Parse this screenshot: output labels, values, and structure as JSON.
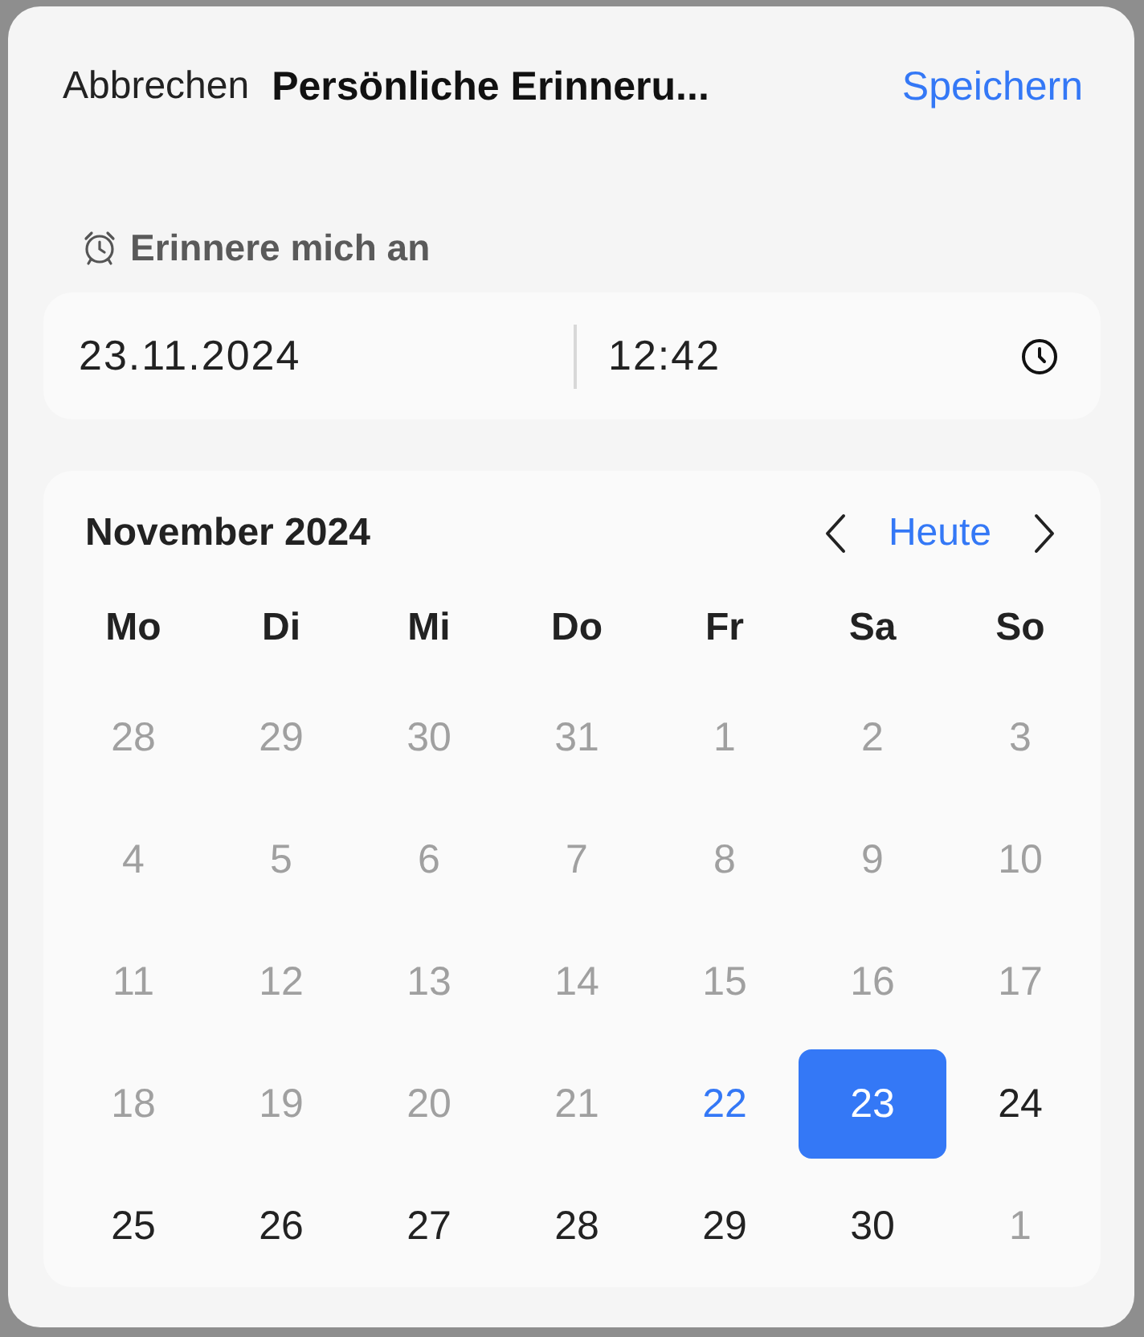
{
  "header": {
    "cancel": "Abbrechen",
    "title": "Persönliche Erinneru...",
    "save": "Speichern"
  },
  "reminder": {
    "label": "Erinnere mich an",
    "date": "23.11.2024",
    "time": "12:42"
  },
  "calendar": {
    "month": "November 2024",
    "today_button": "Heute",
    "weekdays": [
      "Mo",
      "Di",
      "Mi",
      "Do",
      "Fr",
      "Sa",
      "So"
    ],
    "days": [
      {
        "label": "28",
        "kind": "muted",
        "selected": false
      },
      {
        "label": "29",
        "kind": "muted",
        "selected": false
      },
      {
        "label": "30",
        "kind": "muted",
        "selected": false
      },
      {
        "label": "31",
        "kind": "muted",
        "selected": false
      },
      {
        "label": "1",
        "kind": "muted",
        "selected": false
      },
      {
        "label": "2",
        "kind": "muted",
        "selected": false
      },
      {
        "label": "3",
        "kind": "muted",
        "selected": false
      },
      {
        "label": "4",
        "kind": "muted",
        "selected": false
      },
      {
        "label": "5",
        "kind": "muted",
        "selected": false
      },
      {
        "label": "6",
        "kind": "muted",
        "selected": false
      },
      {
        "label": "7",
        "kind": "muted",
        "selected": false
      },
      {
        "label": "8",
        "kind": "muted",
        "selected": false
      },
      {
        "label": "9",
        "kind": "muted",
        "selected": false
      },
      {
        "label": "10",
        "kind": "muted",
        "selected": false
      },
      {
        "label": "11",
        "kind": "muted",
        "selected": false
      },
      {
        "label": "12",
        "kind": "muted",
        "selected": false
      },
      {
        "label": "13",
        "kind": "muted",
        "selected": false
      },
      {
        "label": "14",
        "kind": "muted",
        "selected": false
      },
      {
        "label": "15",
        "kind": "muted",
        "selected": false
      },
      {
        "label": "16",
        "kind": "muted",
        "selected": false
      },
      {
        "label": "17",
        "kind": "muted",
        "selected": false
      },
      {
        "label": "18",
        "kind": "muted",
        "selected": false
      },
      {
        "label": "19",
        "kind": "muted",
        "selected": false
      },
      {
        "label": "20",
        "kind": "muted",
        "selected": false
      },
      {
        "label": "21",
        "kind": "muted",
        "selected": false
      },
      {
        "label": "22",
        "kind": "today",
        "selected": false
      },
      {
        "label": "23",
        "kind": "normal",
        "selected": true
      },
      {
        "label": "24",
        "kind": "normal",
        "selected": false
      },
      {
        "label": "25",
        "kind": "normal",
        "selected": false
      },
      {
        "label": "26",
        "kind": "normal",
        "selected": false
      },
      {
        "label": "27",
        "kind": "normal",
        "selected": false
      },
      {
        "label": "28",
        "kind": "normal",
        "selected": false
      },
      {
        "label": "29",
        "kind": "normal",
        "selected": false
      },
      {
        "label": "30",
        "kind": "normal",
        "selected": false
      },
      {
        "label": "1",
        "kind": "muted",
        "selected": false
      }
    ]
  }
}
